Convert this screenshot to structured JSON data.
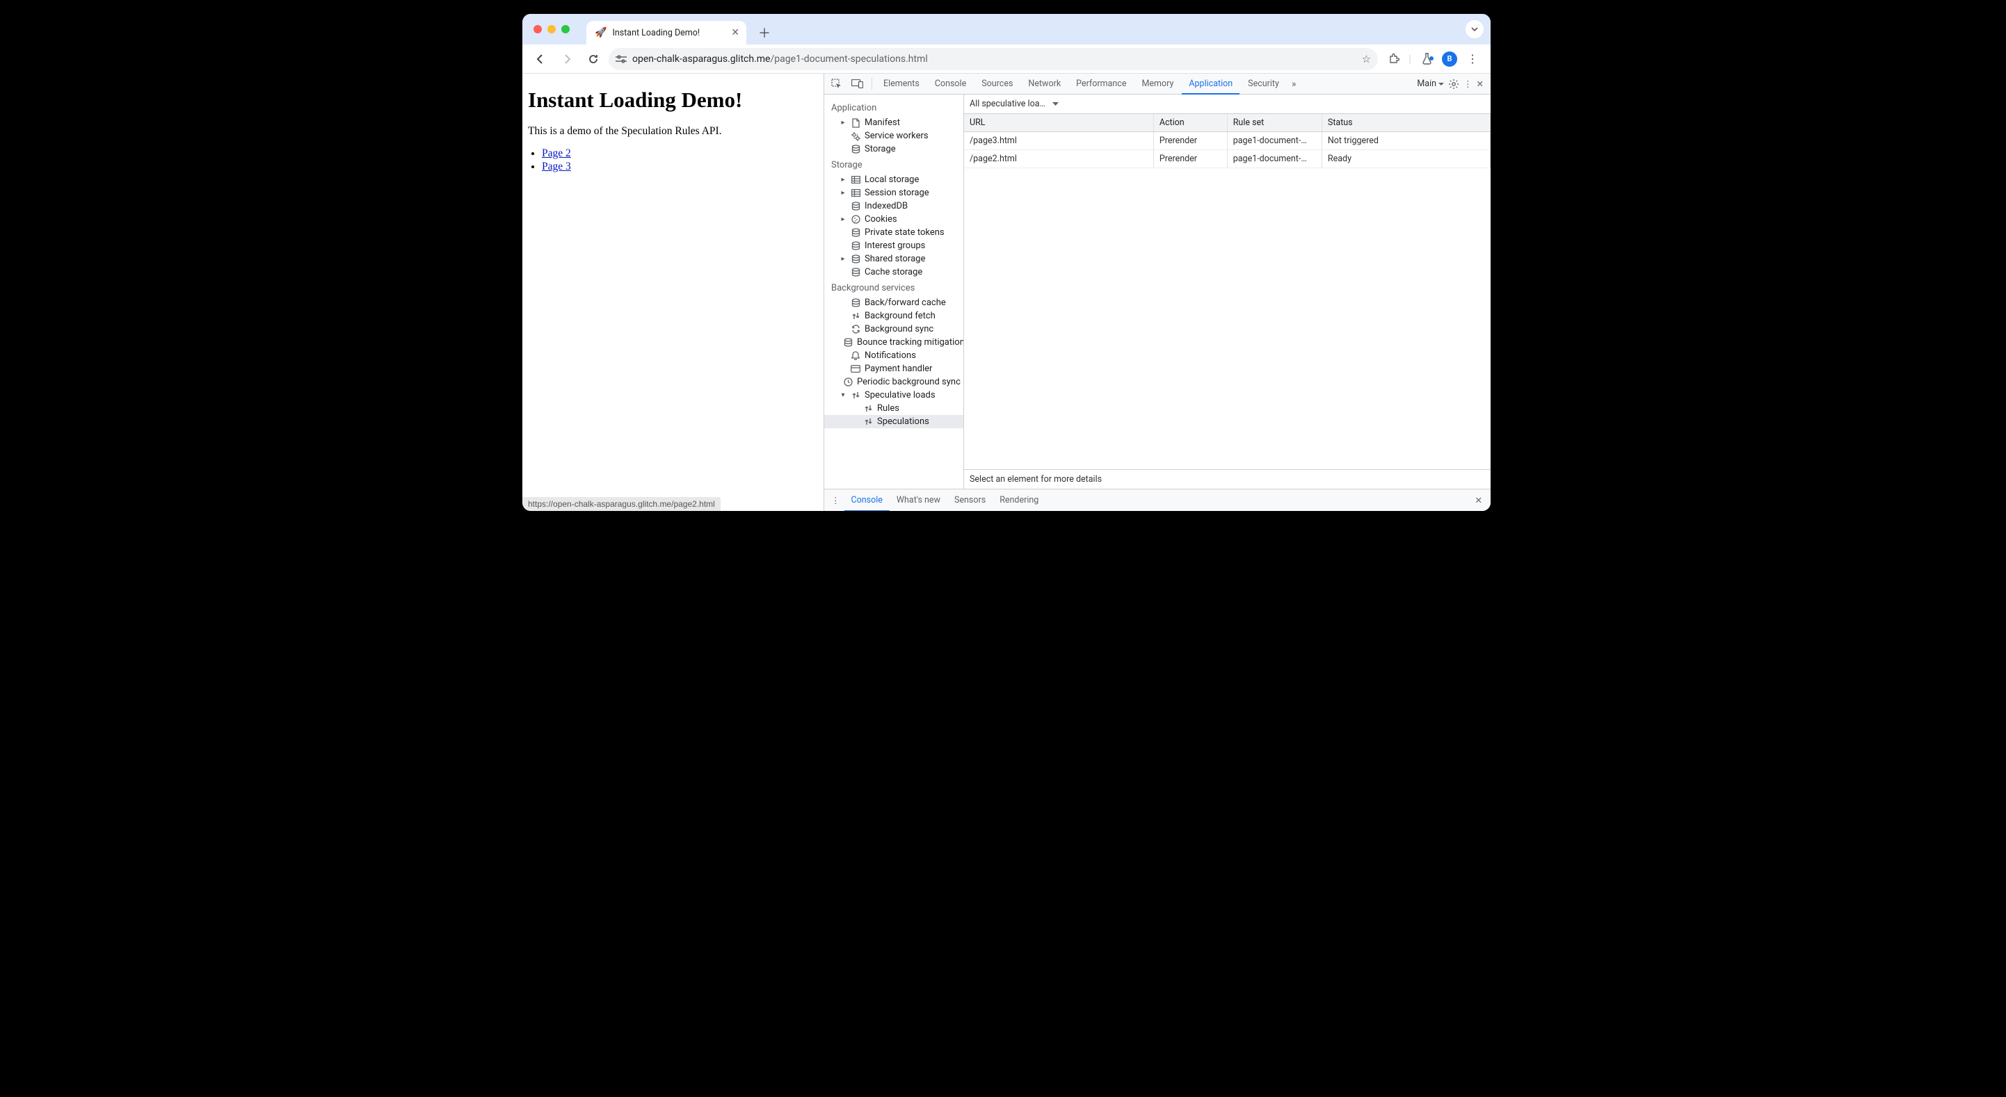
{
  "browser": {
    "tab_title": "Instant Loading Demo!",
    "tab_favicon": "🚀",
    "url_host": "open-chalk-asparagus.glitch.me",
    "url_path": "/page1-document-speculations.html",
    "avatar_letter": "B",
    "status_url": "https://open-chalk-asparagus.glitch.me/page2.html"
  },
  "page": {
    "h1": "Instant Loading Demo!",
    "desc": "This is a demo of the Speculation Rules API.",
    "links": [
      {
        "label": "Page 2"
      },
      {
        "label": "Page 3"
      }
    ]
  },
  "devtools": {
    "tabs": [
      "Elements",
      "Console",
      "Sources",
      "Network",
      "Performance",
      "Memory",
      "Application",
      "Security"
    ],
    "active_tab": "Application",
    "target_label": "Main",
    "drawer_tabs": [
      "Console",
      "What's new",
      "Sensors",
      "Rendering"
    ],
    "drawer_active": "Console"
  },
  "app_sidebar": {
    "groups": [
      {
        "title": "Application",
        "items": [
          {
            "caret": "▸",
            "icon": "file",
            "label": "Manifest",
            "name": "sidebar-manifest"
          },
          {
            "caret": "",
            "icon": "gears",
            "label": "Service workers",
            "name": "sidebar-service-workers"
          },
          {
            "caret": "",
            "icon": "db",
            "label": "Storage",
            "name": "sidebar-storage-app"
          }
        ]
      },
      {
        "title": "Storage",
        "items": [
          {
            "caret": "▸",
            "icon": "grid",
            "label": "Local storage",
            "name": "sidebar-local-storage"
          },
          {
            "caret": "▸",
            "icon": "grid",
            "label": "Session storage",
            "name": "sidebar-session-storage"
          },
          {
            "caret": "",
            "icon": "db",
            "label": "IndexedDB",
            "name": "sidebar-indexeddb"
          },
          {
            "caret": "▸",
            "icon": "cookie",
            "label": "Cookies",
            "name": "sidebar-cookies"
          },
          {
            "caret": "",
            "icon": "db",
            "label": "Private state tokens",
            "name": "sidebar-private-tokens"
          },
          {
            "caret": "",
            "icon": "db",
            "label": "Interest groups",
            "name": "sidebar-interest-groups"
          },
          {
            "caret": "▸",
            "icon": "db",
            "label": "Shared storage",
            "name": "sidebar-shared-storage"
          },
          {
            "caret": "",
            "icon": "db",
            "label": "Cache storage",
            "name": "sidebar-cache-storage"
          }
        ]
      },
      {
        "title": "Background services",
        "items": [
          {
            "caret": "",
            "icon": "db",
            "label": "Back/forward cache",
            "name": "sidebar-bfcache"
          },
          {
            "caret": "",
            "icon": "arrows",
            "label": "Background fetch",
            "name": "sidebar-bg-fetch"
          },
          {
            "caret": "",
            "icon": "sync",
            "label": "Background sync",
            "name": "sidebar-bg-sync"
          },
          {
            "caret": "",
            "icon": "db",
            "label": "Bounce tracking mitigation",
            "name": "sidebar-bounce"
          },
          {
            "caret": "",
            "icon": "bell",
            "label": "Notifications",
            "name": "sidebar-notifications"
          },
          {
            "caret": "",
            "icon": "card",
            "label": "Payment handler",
            "name": "sidebar-payment"
          },
          {
            "caret": "",
            "icon": "clock",
            "label": "Periodic background sync",
            "name": "sidebar-periodic"
          },
          {
            "caret": "▾",
            "icon": "arrows",
            "label": "Speculative loads",
            "name": "sidebar-speculative-loads",
            "expanded": true
          },
          {
            "caret": "",
            "icon": "arrows",
            "label": "Rules",
            "name": "sidebar-spec-rules",
            "child": true
          },
          {
            "caret": "",
            "icon": "arrows",
            "label": "Speculations",
            "name": "sidebar-spec-speculations",
            "child": true,
            "selected": true
          }
        ]
      }
    ]
  },
  "speculations": {
    "filter_label": "All speculative loa…",
    "columns": [
      "URL",
      "Action",
      "Rule set",
      "Status"
    ],
    "rows": [
      {
        "url": "/page3.html",
        "action": "Prerender",
        "rule": "page1-document-…",
        "status": "Not triggered"
      },
      {
        "url": "/page2.html",
        "action": "Prerender",
        "rule": "page1-document-…",
        "status": "Ready"
      }
    ],
    "detail_placeholder": "Select an element for more details"
  }
}
